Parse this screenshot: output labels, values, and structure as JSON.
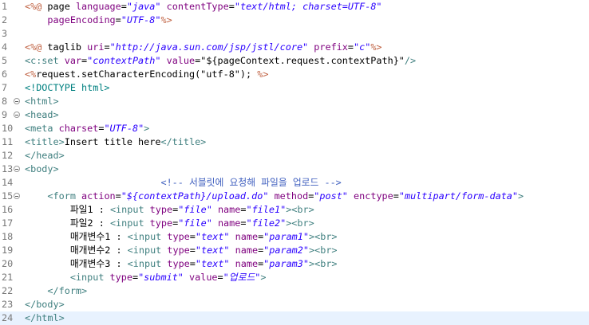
{
  "editor": {
    "current_line": 24,
    "lines": [
      {
        "n": "1",
        "fold": false,
        "indent": "",
        "tokens": [
          [
            "delim",
            "<%@"
          ],
          [
            "el",
            " page "
          ],
          [
            "attr",
            "language"
          ],
          [
            "punct",
            "="
          ],
          [
            "str",
            "\"java\""
          ],
          [
            "el",
            " "
          ],
          [
            "attr",
            "contentType"
          ],
          [
            "punct",
            "="
          ],
          [
            "str",
            "\"text/html; charset=UTF-8\""
          ]
        ]
      },
      {
        "n": "2",
        "fold": false,
        "indent": "    ",
        "tokens": [
          [
            "attr",
            "pageEncoding"
          ],
          [
            "punct",
            "="
          ],
          [
            "str",
            "\"UTF-8\""
          ],
          [
            "delim",
            "%>"
          ]
        ]
      },
      {
        "n": "3",
        "fold": false,
        "indent": "",
        "tokens": []
      },
      {
        "n": "4",
        "fold": false,
        "indent": "",
        "tokens": [
          [
            "delim",
            "<%@"
          ],
          [
            "el",
            " taglib "
          ],
          [
            "attr",
            "uri"
          ],
          [
            "punct",
            "="
          ],
          [
            "str",
            "\"http://java.sun.com/jsp/jstl/core\""
          ],
          [
            "el",
            " "
          ],
          [
            "attr",
            "prefix"
          ],
          [
            "punct",
            "="
          ],
          [
            "str",
            "\"c\""
          ],
          [
            "delim",
            "%>"
          ]
        ]
      },
      {
        "n": "5",
        "fold": false,
        "indent": "",
        "tokens": [
          [
            "tag",
            "<c:set "
          ],
          [
            "attr",
            "var"
          ],
          [
            "punct",
            "="
          ],
          [
            "str",
            "\"contextPath\""
          ],
          [
            "el",
            " "
          ],
          [
            "attr",
            "value"
          ],
          [
            "punct",
            "="
          ],
          [
            "text",
            "\"${pageContext.request.contextPath}\""
          ],
          [
            "tag",
            "/>"
          ]
        ]
      },
      {
        "n": "6",
        "fold": false,
        "indent": "",
        "tokens": [
          [
            "delim",
            "<%"
          ],
          [
            "text",
            "request.setCharacterEncoding(\"utf-8\"); "
          ],
          [
            "delim",
            "%>"
          ]
        ]
      },
      {
        "n": "7",
        "fold": false,
        "indent": "",
        "tokens": [
          [
            "doctype",
            "<!DOCTYPE html>"
          ]
        ]
      },
      {
        "n": "8",
        "fold": true,
        "indent": "",
        "tokens": [
          [
            "tag",
            "<html>"
          ]
        ]
      },
      {
        "n": "9",
        "fold": true,
        "indent": "",
        "tokens": [
          [
            "tag",
            "<head>"
          ]
        ]
      },
      {
        "n": "10",
        "fold": false,
        "indent": "",
        "tokens": [
          [
            "tag",
            "<meta "
          ],
          [
            "attr",
            "charset"
          ],
          [
            "punct",
            "="
          ],
          [
            "str",
            "\"UTF-8\""
          ],
          [
            "tag",
            ">"
          ]
        ]
      },
      {
        "n": "11",
        "fold": false,
        "indent": "",
        "tokens": [
          [
            "tag",
            "<title>"
          ],
          [
            "text",
            "Insert title here"
          ],
          [
            "tag",
            "</title>"
          ]
        ]
      },
      {
        "n": "12",
        "fold": false,
        "indent": "",
        "tokens": [
          [
            "tag",
            "</head>"
          ]
        ]
      },
      {
        "n": "13",
        "fold": true,
        "indent": "",
        "tokens": [
          [
            "tag",
            "<body>"
          ]
        ]
      },
      {
        "n": "14",
        "fold": false,
        "indent": "                        ",
        "tokens": [
          [
            "comment",
            "<!-- 서블릿에 요청해 파일을 업로드 -->"
          ]
        ]
      },
      {
        "n": "15",
        "fold": true,
        "indent": "    ",
        "tokens": [
          [
            "tag",
            "<form "
          ],
          [
            "attr",
            "action"
          ],
          [
            "punct",
            "="
          ],
          [
            "str",
            "\"${contextPath}/upload.do\""
          ],
          [
            "el",
            " "
          ],
          [
            "attr",
            "method"
          ],
          [
            "punct",
            "="
          ],
          [
            "str",
            "\"post\""
          ],
          [
            "el",
            " "
          ],
          [
            "attr",
            "enctype"
          ],
          [
            "punct",
            "="
          ],
          [
            "str",
            "\"multipart/form-data\""
          ],
          [
            "tag",
            ">"
          ]
        ]
      },
      {
        "n": "16",
        "fold": false,
        "indent": "        ",
        "tokens": [
          [
            "text",
            "파일1 : "
          ],
          [
            "tag",
            "<input "
          ],
          [
            "attr",
            "type"
          ],
          [
            "punct",
            "="
          ],
          [
            "str",
            "\"file\""
          ],
          [
            "el",
            " "
          ],
          [
            "attr",
            "name"
          ],
          [
            "punct",
            "="
          ],
          [
            "str",
            "\"file1\""
          ],
          [
            "tag",
            ">"
          ],
          [
            "tag",
            "<br>"
          ]
        ]
      },
      {
        "n": "17",
        "fold": false,
        "indent": "        ",
        "tokens": [
          [
            "text",
            "파일2 : "
          ],
          [
            "tag",
            "<input "
          ],
          [
            "attr",
            "type"
          ],
          [
            "punct",
            "="
          ],
          [
            "str",
            "\"file\""
          ],
          [
            "el",
            " "
          ],
          [
            "attr",
            "name"
          ],
          [
            "punct",
            "="
          ],
          [
            "str",
            "\"file2\""
          ],
          [
            "tag",
            ">"
          ],
          [
            "tag",
            "<br>"
          ]
        ]
      },
      {
        "n": "18",
        "fold": false,
        "indent": "        ",
        "tokens": [
          [
            "text",
            "매개변수1 : "
          ],
          [
            "tag",
            "<input "
          ],
          [
            "attr",
            "type"
          ],
          [
            "punct",
            "="
          ],
          [
            "str",
            "\"text\""
          ],
          [
            "el",
            " "
          ],
          [
            "attr",
            "name"
          ],
          [
            "punct",
            "="
          ],
          [
            "str",
            "\"param1\""
          ],
          [
            "tag",
            ">"
          ],
          [
            "tag",
            "<br>"
          ]
        ]
      },
      {
        "n": "19",
        "fold": false,
        "indent": "        ",
        "tokens": [
          [
            "text",
            "매개변수2 : "
          ],
          [
            "tag",
            "<input "
          ],
          [
            "attr",
            "type"
          ],
          [
            "punct",
            "="
          ],
          [
            "str",
            "\"text\""
          ],
          [
            "el",
            " "
          ],
          [
            "attr",
            "name"
          ],
          [
            "punct",
            "="
          ],
          [
            "str",
            "\"param2\""
          ],
          [
            "tag",
            ">"
          ],
          [
            "tag",
            "<br>"
          ]
        ]
      },
      {
        "n": "20",
        "fold": false,
        "indent": "        ",
        "tokens": [
          [
            "text",
            "매개변수3 : "
          ],
          [
            "tag",
            "<input "
          ],
          [
            "attr",
            "type"
          ],
          [
            "punct",
            "="
          ],
          [
            "str",
            "\"text\""
          ],
          [
            "el",
            " "
          ],
          [
            "attr",
            "name"
          ],
          [
            "punct",
            "="
          ],
          [
            "str",
            "\"param3\""
          ],
          [
            "tag",
            ">"
          ],
          [
            "tag",
            "<br>"
          ]
        ]
      },
      {
        "n": "21",
        "fold": false,
        "indent": "        ",
        "tokens": [
          [
            "tag",
            "<input "
          ],
          [
            "attr",
            "type"
          ],
          [
            "punct",
            "="
          ],
          [
            "str",
            "\"submit\""
          ],
          [
            "el",
            " "
          ],
          [
            "attr",
            "value"
          ],
          [
            "punct",
            "="
          ],
          [
            "str",
            "\"업로드\""
          ],
          [
            "tag",
            ">"
          ]
        ]
      },
      {
        "n": "22",
        "fold": false,
        "indent": "    ",
        "tokens": [
          [
            "tag",
            "</form>"
          ]
        ]
      },
      {
        "n": "23",
        "fold": false,
        "indent": "",
        "tokens": [
          [
            "tag",
            "</body>"
          ]
        ]
      },
      {
        "n": "24",
        "fold": false,
        "indent": "",
        "tokens": [
          [
            "tag",
            "</html>"
          ]
        ]
      }
    ]
  }
}
